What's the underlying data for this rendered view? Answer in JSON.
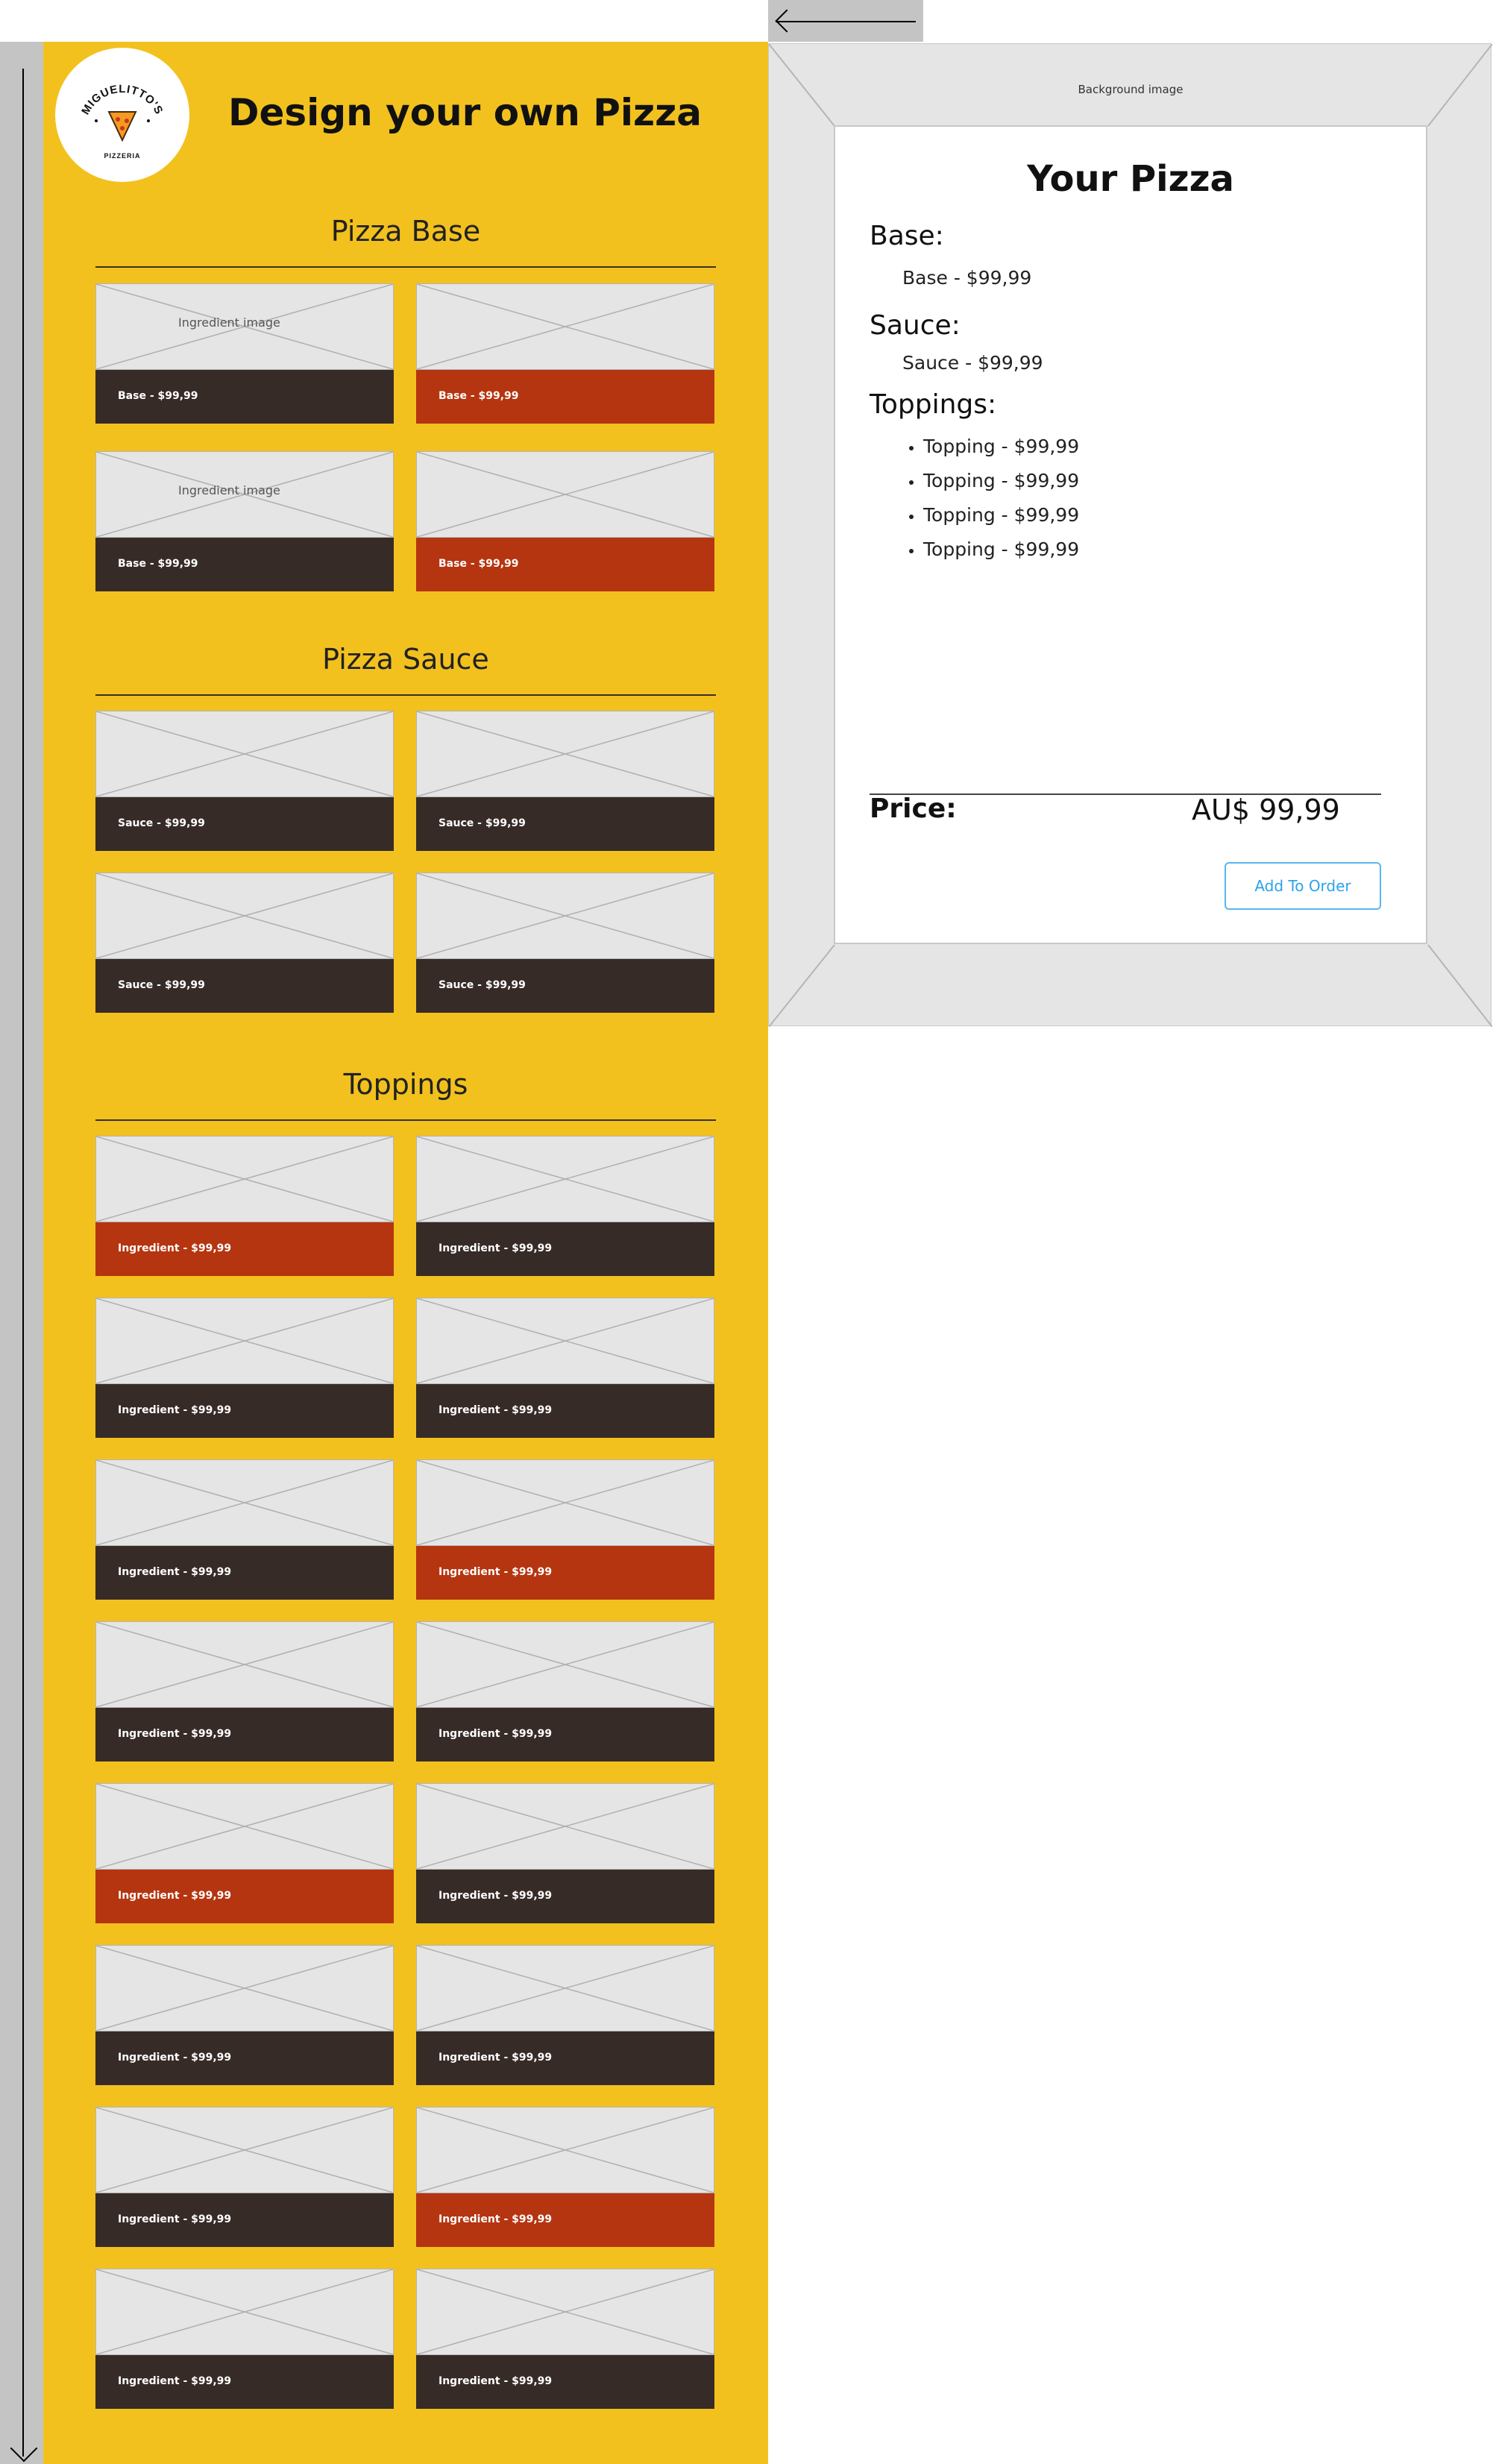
{
  "page": {
    "title": "Design your own Pizza",
    "logo": {
      "name": "MIGUELITTO'S",
      "sub": "PIZZERIA"
    }
  },
  "sections": {
    "base": {
      "title": "Pizza Base",
      "cards": [
        {
          "label": "Base - $99,99",
          "caption": "Ingredient image",
          "selected": false
        },
        {
          "label": "Base - $99,99",
          "caption": "",
          "selected": true
        },
        {
          "label": "Base - $99,99",
          "caption": "Ingredient image",
          "selected": false
        },
        {
          "label": "Base - $99,99",
          "caption": "",
          "selected": true
        }
      ]
    },
    "sauce": {
      "title": "Pizza Sauce",
      "cards": [
        {
          "label": "Sauce - $99,99",
          "caption": "",
          "selected": false
        },
        {
          "label": "Sauce - $99,99",
          "caption": "",
          "selected": false
        },
        {
          "label": "Sauce - $99,99",
          "caption": "",
          "selected": false
        },
        {
          "label": "Sauce - $99,99",
          "caption": "",
          "selected": false
        }
      ]
    },
    "toppings": {
      "title": "Toppings",
      "cards": [
        {
          "label": "Ingredient - $99,99",
          "caption": "",
          "selected": true
        },
        {
          "label": "Ingredient - $99,99",
          "caption": "",
          "selected": false
        },
        {
          "label": "Ingredient - $99,99",
          "caption": "",
          "selected": false
        },
        {
          "label": "Ingredient - $99,99",
          "caption": "",
          "selected": false
        },
        {
          "label": "Ingredient - $99,99",
          "caption": "",
          "selected": false
        },
        {
          "label": "Ingredient - $99,99",
          "caption": "",
          "selected": true
        },
        {
          "label": "Ingredient - $99,99",
          "caption": "",
          "selected": false
        },
        {
          "label": "Ingredient - $99,99",
          "caption": "",
          "selected": false
        },
        {
          "label": "Ingredient - $99,99",
          "caption": "",
          "selected": true
        },
        {
          "label": "Ingredient - $99,99",
          "caption": "",
          "selected": false
        },
        {
          "label": "Ingredient - $99,99",
          "caption": "",
          "selected": false
        },
        {
          "label": "Ingredient - $99,99",
          "caption": "",
          "selected": false
        },
        {
          "label": "Ingredient - $99,99",
          "caption": "",
          "selected": false
        },
        {
          "label": "Ingredient - $99,99",
          "caption": "",
          "selected": true
        },
        {
          "label": "Ingredient - $99,99",
          "caption": "",
          "selected": false
        },
        {
          "label": "Ingredient - $99,99",
          "caption": "",
          "selected": false
        }
      ]
    }
  },
  "summary": {
    "background_label": "Background image",
    "title": "Your Pizza",
    "base_label": "Base:",
    "base_item": "Base - $99,99",
    "sauce_label": "Sauce:",
    "sauce_item": "Sauce - $99,99",
    "toppings_label": "Toppings:",
    "toppings": [
      "Topping - $99,99",
      "Topping - $99,99",
      "Topping - $99,99",
      "Topping - $99,99"
    ],
    "price_label": "Price:",
    "price_value": "AU$ 99,99",
    "add_button": "Add To Order"
  },
  "colors": {
    "panel": "#f2c11e",
    "card_bar": "#372b28",
    "card_bar_selected": "#b53510",
    "button_accent": "#2ba3e8"
  },
  "icons": {
    "scroll_down": "arrow-down-icon",
    "scroll_left": "arrow-left-icon",
    "placeholder": "image-placeholder-icon"
  }
}
